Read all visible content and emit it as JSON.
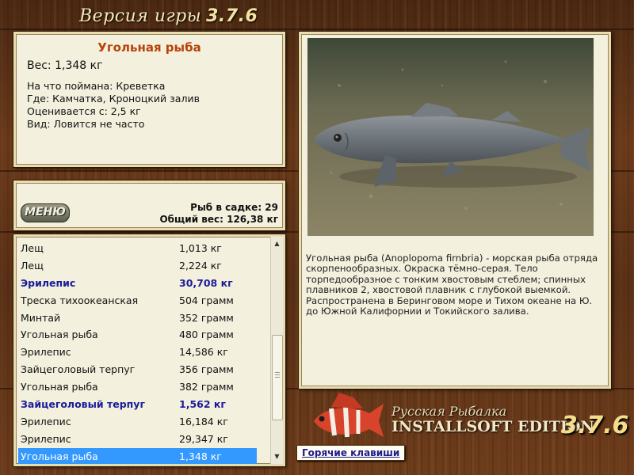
{
  "header": {
    "title": "Версия игры",
    "version": "3.7.6"
  },
  "fish_info": {
    "name": "Угольная рыба",
    "weight": "Вес: 1,348 кг",
    "lines": [
      "На что поймана: Креветка",
      "Где: Камчатка, Кроноцкий залив",
      "Оценивается с: 2,5 кг",
      "Вид: Ловится не часто"
    ]
  },
  "keep": {
    "menu_label": "МЕНЮ",
    "fish_count": "Рыб в садке: 29",
    "total_weight": "Общий вес: 126,38 кг"
  },
  "catch_list": [
    {
      "name": "Лещ",
      "weight": "1,013 кг",
      "highlight": false,
      "selected": false
    },
    {
      "name": "Лещ",
      "weight": "2,224 кг",
      "highlight": false,
      "selected": false
    },
    {
      "name": "Эрилепис",
      "weight": "30,708 кг",
      "highlight": true,
      "selected": false
    },
    {
      "name": "Треска тихоокеанская",
      "weight": "504 грамм",
      "highlight": false,
      "selected": false
    },
    {
      "name": "Минтай",
      "weight": "352 грамм",
      "highlight": false,
      "selected": false
    },
    {
      "name": "Угольная рыба",
      "weight": "480 грамм",
      "highlight": false,
      "selected": false
    },
    {
      "name": "Эрилепис",
      "weight": "14,586 кг",
      "highlight": false,
      "selected": false
    },
    {
      "name": "Зайцеголовый терпуг",
      "weight": "356 грамм",
      "highlight": false,
      "selected": false
    },
    {
      "name": "Угольная рыба",
      "weight": "382 грамм",
      "highlight": false,
      "selected": false
    },
    {
      "name": "Зайцеголовый терпуг",
      "weight": "1,562 кг",
      "highlight": true,
      "selected": false
    },
    {
      "name": "Эрилепис",
      "weight": "16,184 кг",
      "highlight": false,
      "selected": false
    },
    {
      "name": "Эрилепис",
      "weight": "29,347 кг",
      "highlight": false,
      "selected": false
    },
    {
      "name": "Угольная рыба",
      "weight": "1,348 кг",
      "highlight": false,
      "selected": true
    }
  ],
  "description": "Угольная рыба (Anoplopoma firnbria) - морская рыба отряда скорпенообразных. Окраска тёмно-серая. Тело торпедообразное с тонким хвостовым стеблем; спинных плавников 2, хвостовой плавник с глубокой выемкой. Распространена в Беринговом море и Тихом океане на Ю. до Южной Калифорнии и Токийского залива.",
  "logo": {
    "line1": "Русская Рыбалка",
    "line2": "INSTALLSOFT EDITION",
    "version": "3.7.6"
  },
  "hotkeys_label": "Горячие клавиши",
  "colors": {
    "fish_name": "#b8430a",
    "highlight": "#1b1b9a",
    "selection": "#3399ff",
    "panel_bg": "#f3f0dd"
  }
}
